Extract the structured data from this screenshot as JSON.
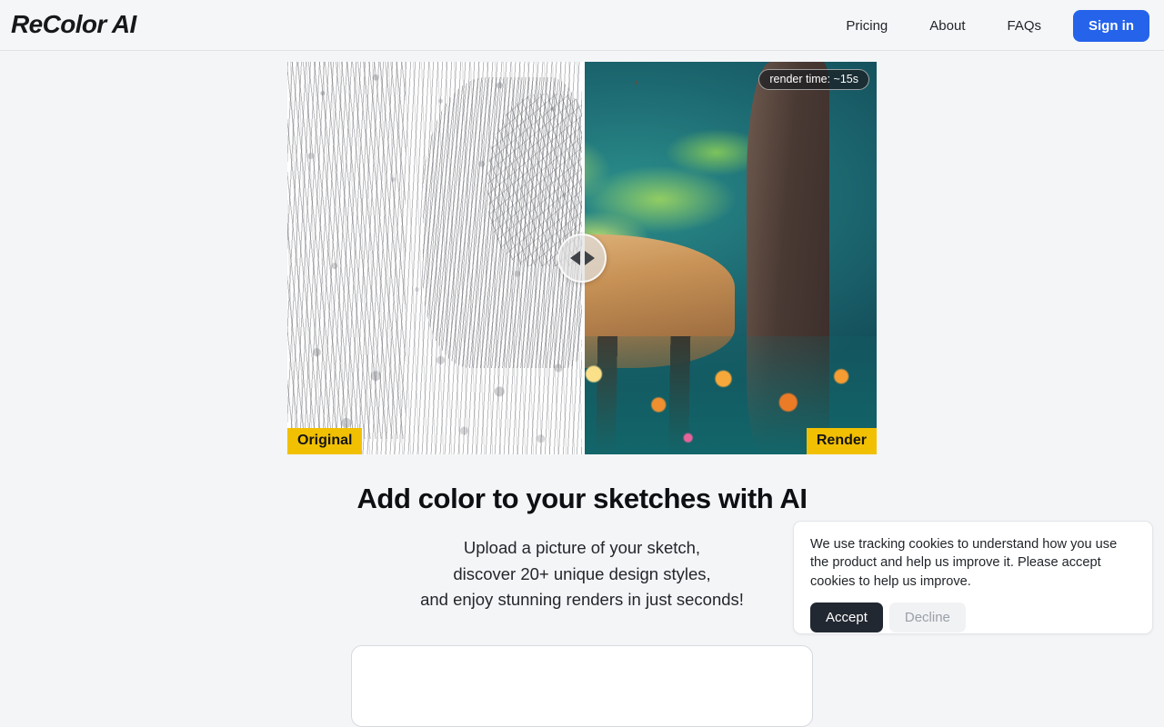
{
  "header": {
    "logo": "ReColor AI",
    "nav": [
      {
        "label": "Pricing",
        "name": "nav-link-pricing"
      },
      {
        "label": "About",
        "name": "nav-link-about"
      },
      {
        "label": "FAQs",
        "name": "nav-link-faqs"
      }
    ],
    "signin_label": "Sign in",
    "accent_color": "#2563eb"
  },
  "comparison": {
    "render_time_badge": "render time: ~15s",
    "original_tag": "Original",
    "render_tag": "Render",
    "tag_color": "#f2c002",
    "slider_position_percent": 50,
    "left_image_description": "black and white line-art sketch of a waterfall in a forest with a deer",
    "right_image_description": "AI colorized painting of a stag in a lush teal forest with orange flowers"
  },
  "hero": {
    "title": "Add color to your sketches with AI",
    "subtitle_line1": "Upload a picture of your sketch,",
    "subtitle_line2": "discover 20+ unique design styles,",
    "subtitle_line3": "and enjoy stunning renders in just seconds!"
  },
  "cookie_banner": {
    "message": "We use tracking cookies to understand how you use the product and help us improve it. Please accept cookies to help us improve.",
    "accept_label": "Accept",
    "decline_label": "Decline",
    "accept_color": "#222831"
  }
}
